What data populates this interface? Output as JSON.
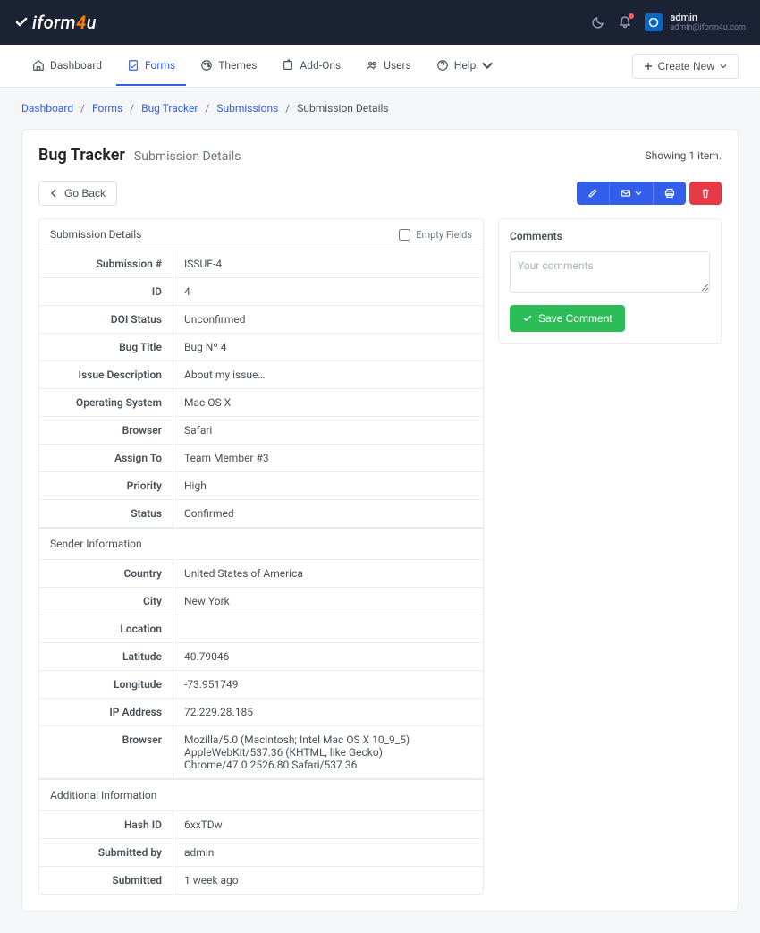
{
  "topbar": {
    "user_name": "admin",
    "user_email": "admin@iform4u.com"
  },
  "nav": {
    "items": [
      {
        "label": "Dashboard"
      },
      {
        "label": "Forms"
      },
      {
        "label": "Themes"
      },
      {
        "label": "Add-Ons"
      },
      {
        "label": "Users"
      },
      {
        "label": "Help"
      }
    ],
    "create_label": "Create New"
  },
  "breadcrumb": [
    {
      "label": "Dashboard"
    },
    {
      "label": "Forms"
    },
    {
      "label": "Bug Tracker"
    },
    {
      "label": "Submissions"
    },
    {
      "label": "Submission Details"
    }
  ],
  "header": {
    "title": "Bug Tracker",
    "subtitle": "Submission Details",
    "showing": "Showing 1 item."
  },
  "toolbar": {
    "go_back": "Go Back"
  },
  "details": {
    "panel_title": "Submission Details",
    "empty_fields_label": "Empty Fields",
    "sections": {
      "sender": "Sender Information",
      "additional": "Additional Information"
    },
    "labels": {
      "submission_no": "Submission #",
      "id": "ID",
      "doi_status": "DOI Status",
      "bug_title": "Bug Title",
      "issue_desc": "Issue Description",
      "os": "Operating System",
      "browser": "Browser",
      "assign_to": "Assign To",
      "priority": "Priority",
      "status": "Status",
      "country": "Country",
      "city": "City",
      "location": "Location",
      "latitude": "Latitude",
      "longitude": "Longitude",
      "ip": "IP Address",
      "browser2": "Browser",
      "hash_id": "Hash ID",
      "submitted_by": "Submitted by",
      "submitted": "Submitted"
    },
    "values": {
      "submission_no": "ISSUE-4",
      "id": "4",
      "doi_status": "Unconfirmed",
      "bug_title": "Bug Nº 4",
      "issue_desc": "About my issue…",
      "os": "Mac OS X",
      "browser": "Safari",
      "assign_to": "Team Member #3",
      "priority": "High",
      "status": "Confirmed",
      "country": "United States of America",
      "city": "New York",
      "location": "",
      "latitude": "40.79046",
      "longitude": "-73.951749",
      "ip": "72.229.28.185",
      "browser2": "Mozilla/5.0 (Macintosh; Intel Mac OS X 10_9_5) AppleWebKit/537.36 (KHTML, like Gecko) Chrome/47.0.2526.80 Safari/537.36",
      "hash_id": "6xxTDw",
      "submitted_by": "admin",
      "submitted": "1 week ago"
    }
  },
  "comments": {
    "title": "Comments",
    "placeholder": "Your comments",
    "save_label": "Save Comment"
  }
}
